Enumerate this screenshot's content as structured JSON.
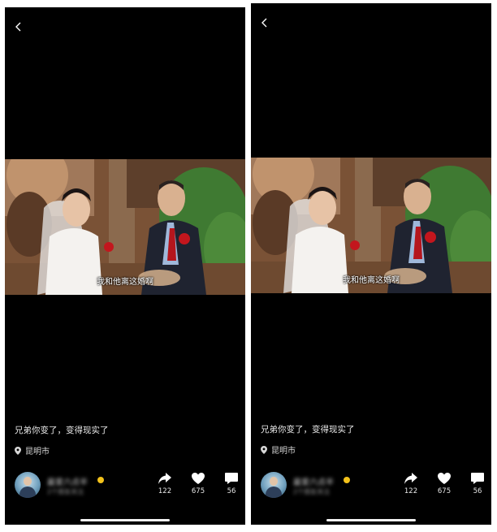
{
  "screens": [
    {
      "subtitle": "我和他离这婚啊",
      "caption": "兄弟你变了，变得现实了",
      "location": "昆明市",
      "author": {
        "name": "最爱六点半",
        "sub": "2个朋友关注",
        "avatar": "avatar-image",
        "badge": "vip-badge"
      },
      "actions": {
        "share": {
          "icon": "share-icon",
          "count": "122"
        },
        "like": {
          "icon": "heart-icon",
          "count": "675"
        },
        "comment": {
          "icon": "comment-icon",
          "count": "56"
        }
      }
    },
    {
      "subtitle": "我和他离这婚啊",
      "caption": "兄弟你变了，变得现实了",
      "location": "昆明市",
      "author": {
        "name": "最爱六点半",
        "sub": "2个朋友关注",
        "avatar": "avatar-image",
        "badge": "vip-badge"
      },
      "actions": {
        "share": {
          "icon": "share-icon",
          "count": "122"
        },
        "like": {
          "icon": "heart-icon",
          "count": "675"
        },
        "comment": {
          "icon": "comment-icon",
          "count": "56"
        }
      }
    }
  ],
  "colors": {
    "background": "#000000",
    "text": "#ffffff",
    "badge": "#f3c21b"
  }
}
